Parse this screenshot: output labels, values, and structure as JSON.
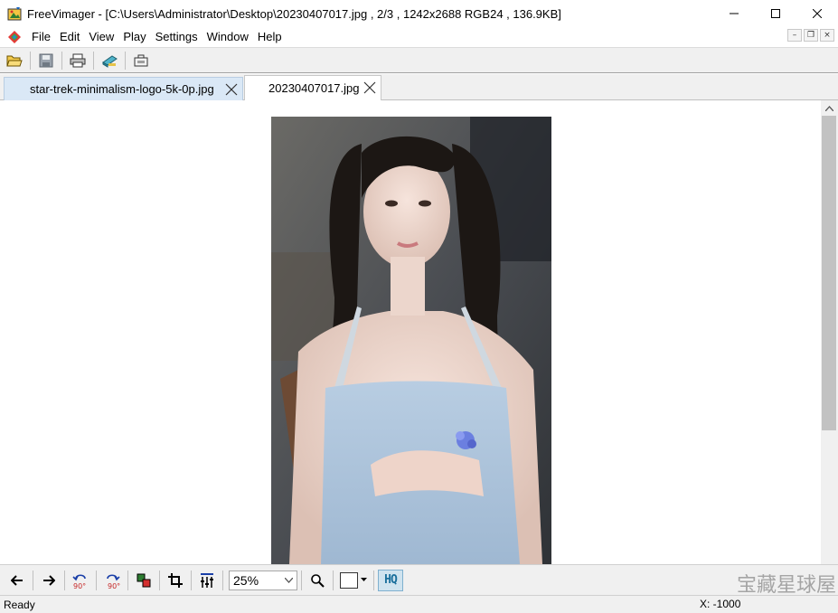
{
  "window": {
    "title": "FreeVimager - [C:\\Users\\Administrator\\Desktop\\20230407017.jpg , 2/3 , 1242x2688 RGB24 , 136.9KB]"
  },
  "menu": {
    "items": [
      "File",
      "Edit",
      "View",
      "Play",
      "Settings",
      "Window",
      "Help"
    ]
  },
  "toolbar": {
    "icons": [
      "open-folder-icon",
      "save-icon",
      "print-icon",
      "scan-icon",
      "capture-icon"
    ]
  },
  "tabs": [
    {
      "label": "star-trek-minimalism-logo-5k-0p.jpg",
      "active": false
    },
    {
      "label": "20230407017.jpg",
      "active": true
    }
  ],
  "bottom_toolbar": {
    "zoom_value": "25%",
    "hq_label": "HQ",
    "watermark": "宝藏星球屋"
  },
  "status": {
    "left": "Ready",
    "right": "X: -1000"
  },
  "colors": {
    "accent": "#1a6f9c",
    "tab_inactive_bg": "#dae8f6",
    "toolbar_bg": "#f0f0f0"
  }
}
